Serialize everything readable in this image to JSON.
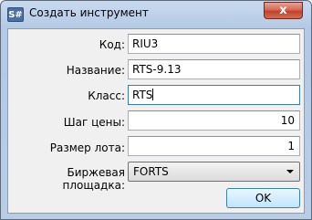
{
  "window": {
    "title": "Создать инструмент",
    "icon_text": "S#",
    "close_label": "x"
  },
  "form": {
    "code": {
      "label": "Код:",
      "value": "RIU3"
    },
    "name": {
      "label": "Название:",
      "value": "RTS-9.13"
    },
    "class": {
      "label": "Класс:",
      "value": "RTS"
    },
    "price_step": {
      "label": "Шаг цены:",
      "value": "10"
    },
    "lot_size": {
      "label": "Размер лота:",
      "value": "1"
    },
    "exchange": {
      "label": "Биржевая площадка:",
      "value": "FORTS"
    }
  },
  "buttons": {
    "ok_label": "OK"
  }
}
